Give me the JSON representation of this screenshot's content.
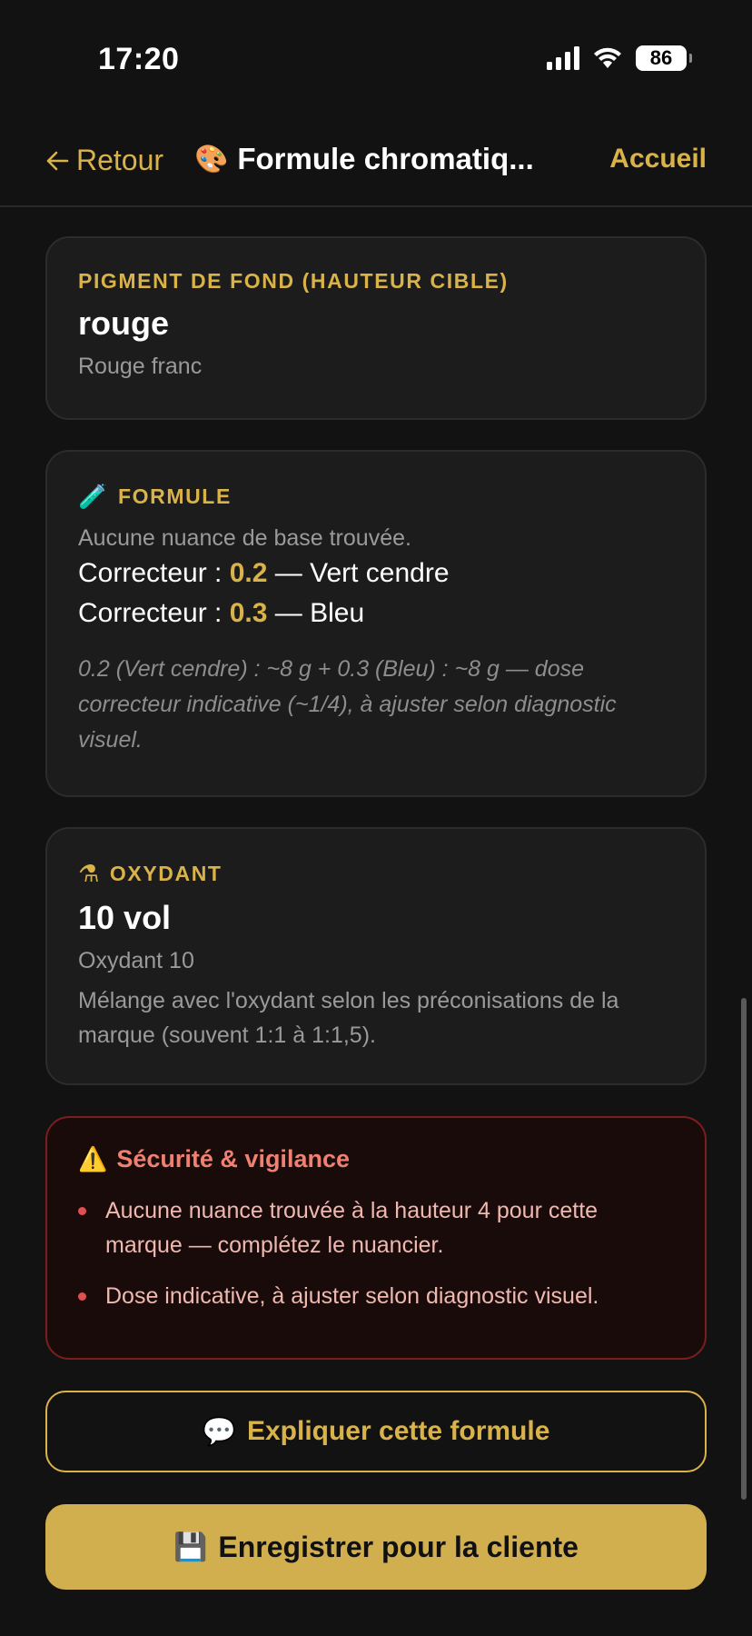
{
  "status_bar": {
    "time": "17:20",
    "battery": "86"
  },
  "nav": {
    "back_label": "Retour",
    "title_icon": "🎨",
    "title": "Formule chromatiq...",
    "home_label": "Accueil"
  },
  "pigment_card": {
    "eyebrow": "PIGMENT DE FOND (HAUTEUR CIBLE)",
    "value": "rouge",
    "description": "Rouge franc"
  },
  "formula_card": {
    "icon": "🧪",
    "eyebrow": "FORMULE",
    "note": "Aucune nuance de base trouvée.",
    "correctors": [
      {
        "prefix": "Correcteur : ",
        "value": "0.2",
        "suffix": " — Vert cendre"
      },
      {
        "prefix": "Correcteur : ",
        "value": "0.3",
        "suffix": " — Bleu"
      }
    ],
    "dose_note": "0.2 (Vert cendre) : ~8 g  +  0.3 (Bleu) : ~8 g  — dose correcteur indicative (~1/4), à ajuster selon diagnostic visuel."
  },
  "oxidant_card": {
    "icon": "⚗",
    "eyebrow": "OXYDANT",
    "value": "10 vol",
    "subtitle": "Oxydant 10",
    "description": "Mélange avec l'oxydant selon les préconisations de la marque (souvent 1:1 à 1:1,5)."
  },
  "warning_card": {
    "icon": "⚠️",
    "title": "Sécurité & vigilance",
    "items": [
      "Aucune nuance trouvée à la hauteur 4 pour cette marque — complétez le nuancier.",
      "Dose indicative, à ajuster selon diagnostic visuel."
    ]
  },
  "actions": {
    "explain_icon": "💬",
    "explain_label": "Expliquer cette formule",
    "save_icon": "💾",
    "save_label": "Enregistrer pour la cliente"
  },
  "colors": {
    "accent": "#d9b24a",
    "background": "#121212",
    "card": "#1c1c1c",
    "danger_border": "#7a1e1e",
    "danger_text": "#f08070"
  }
}
